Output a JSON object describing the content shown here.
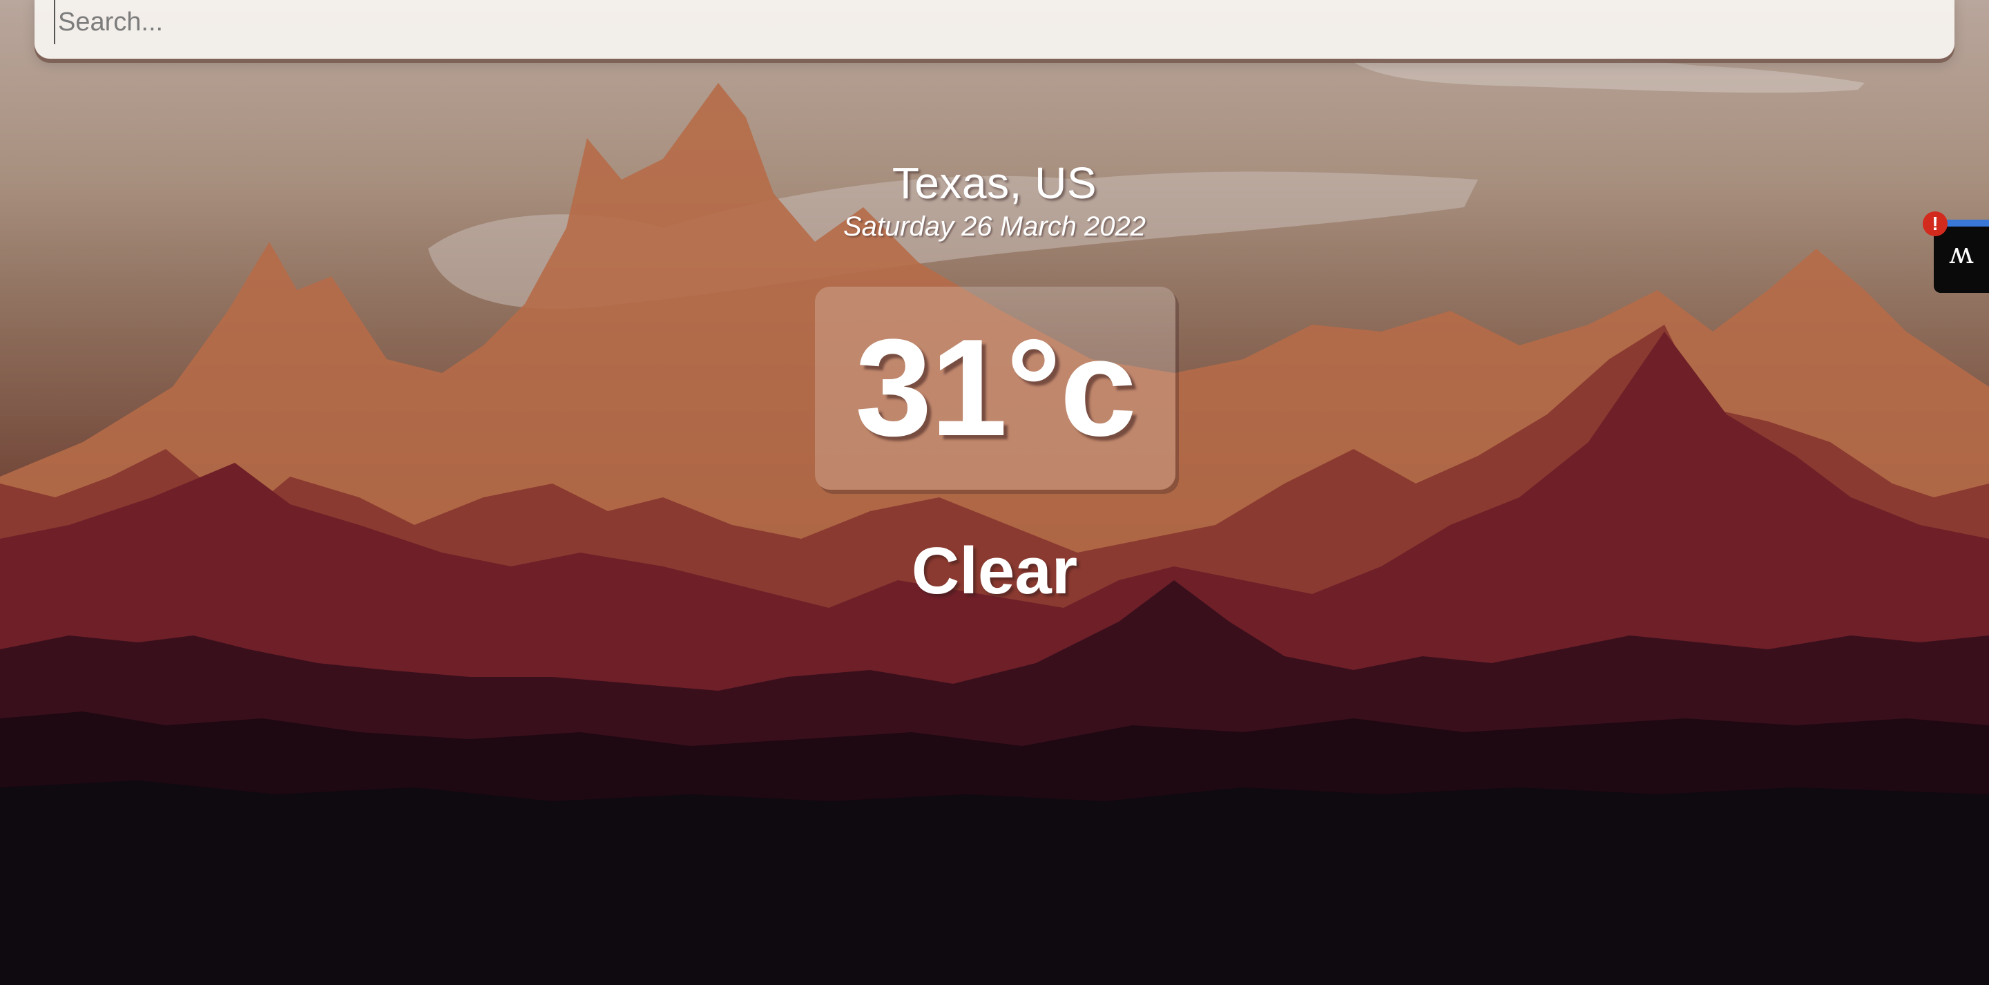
{
  "search": {
    "placeholder": "Search...",
    "value": ""
  },
  "location": {
    "city": "Texas, US",
    "date": "Saturday 26 March 2022"
  },
  "weather": {
    "temperature": "31°c",
    "condition": "Clear"
  },
  "extension": {
    "icon": "monkey-extension-icon",
    "alert": "!"
  },
  "colors": {
    "text": "#ffffff",
    "search_bg": "#f5f2ee",
    "alert": "#d32a1e",
    "extension_accent": "#3a78d8"
  }
}
